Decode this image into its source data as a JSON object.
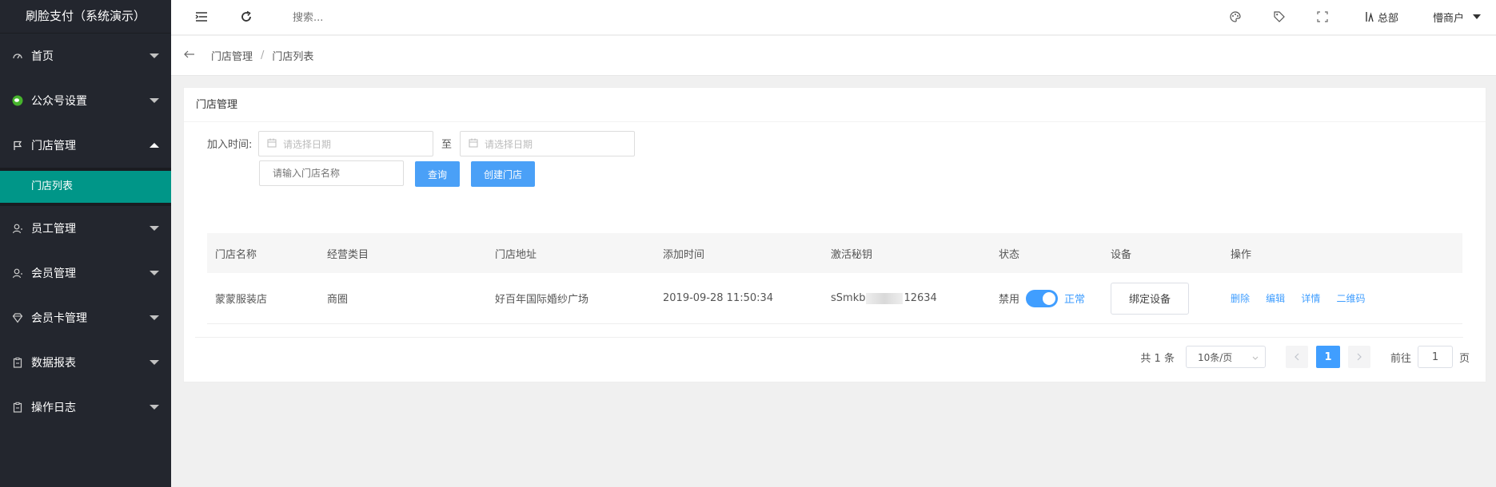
{
  "app": {
    "title": "刷脸支付（系统演示）"
  },
  "sidebar": {
    "items": [
      {
        "label": "首页",
        "icon": "dashboard-icon"
      },
      {
        "label": "公众号设置",
        "icon": "wechat-icon"
      },
      {
        "label": "门店管理",
        "icon": "flag-icon",
        "expanded": true,
        "children": [
          {
            "label": "门店列表",
            "active": true
          }
        ]
      },
      {
        "label": "员工管理",
        "icon": "user-icon"
      },
      {
        "label": "会员管理",
        "icon": "user-icon"
      },
      {
        "label": "会员卡管理",
        "icon": "diamond-icon"
      },
      {
        "label": "数据报表",
        "icon": "clipboard-icon"
      },
      {
        "label": "操作日志",
        "icon": "clipboard-icon"
      }
    ]
  },
  "header": {
    "search_placeholder": "搜索...",
    "hq_label": "总部",
    "user_label": "懵商户"
  },
  "breadcrumb": {
    "items": [
      "门店管理",
      "门店列表"
    ],
    "separator": "/"
  },
  "card": {
    "title": "门店管理",
    "filters": {
      "join_time_label": "加入时间:",
      "start_placeholder": "请选择日期",
      "to_label": "至",
      "end_placeholder": "请选择日期",
      "name_placeholder": "请输入门店名称",
      "query_button": "查询",
      "create_button": "创建门店"
    },
    "table": {
      "columns": [
        "门店名称",
        "经营类目",
        "门店地址",
        "添加时间",
        "激活秘钥",
        "状态",
        "设备",
        "操作"
      ],
      "rows": [
        {
          "name": "蒙蒙服装店",
          "category": "商圈",
          "address": "好百年国际婚纱广场",
          "added_time": "2019-09-28 11:50:34",
          "key_prefix": "sSmkb",
          "key_suffix": "12634",
          "status_off": "禁用",
          "status_on": "正常",
          "device_button": "绑定设备",
          "actions": {
            "delete": "删除",
            "edit": "编辑",
            "detail": "详情",
            "qrcode": "二维码"
          }
        }
      ]
    },
    "pagination": {
      "total_text": "共 1 条",
      "page_size": "10条/页",
      "current_page": "1",
      "goto_prefix": "前往",
      "goto_value": "1",
      "goto_suffix": "页"
    }
  },
  "colors": {
    "sidebar_bg": "#23262e",
    "active_teal": "#009688",
    "primary_blue": "#409eff",
    "wechat_green": "#46b32c"
  }
}
